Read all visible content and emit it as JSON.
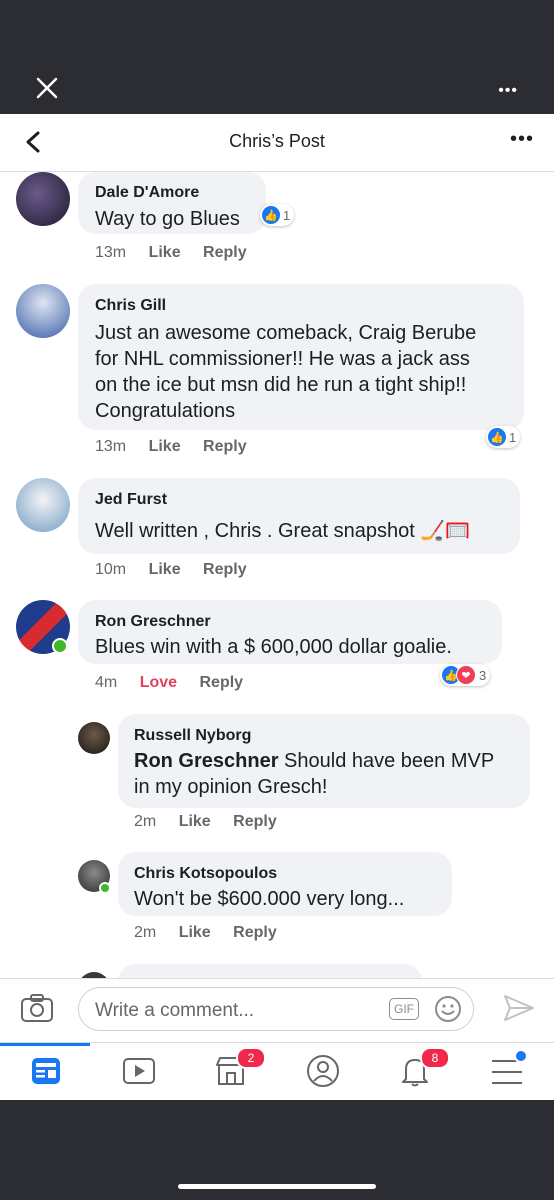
{
  "header": {
    "title": "Chris’s Post",
    "top_more": "•••",
    "more": "•••"
  },
  "comments": [
    {
      "author": "Dale D'Amore",
      "text": "Way to go Blues",
      "time": "13m",
      "like": "Like",
      "reply": "Reply",
      "reaction_count": "1"
    },
    {
      "author": "Chris Gill",
      "lines": [
        "Just an awesome comeback, Craig Berube",
        "for NHL commissioner!! He was a jack ass",
        "on the ice but msn did he run a tight ship!!",
        "Congratulations"
      ],
      "time": "13m",
      "like": "Like",
      "reply": "Reply",
      "reaction_count": "1"
    },
    {
      "author": "Jed Furst",
      "text": "Well written , Chris . Great snapshot 🏒🥅",
      "time": "10m",
      "like": "Like",
      "reply": "Reply"
    },
    {
      "author": "Ron Greschner",
      "text": "Blues win with a $ 600,000 dollar goalie.",
      "time": "4m",
      "like": "Love",
      "reply": "Reply",
      "reaction_count": "3"
    }
  ],
  "replies": [
    {
      "author": "Russell Nyborg",
      "mention": "Ron Greschner",
      "text": " Should have been MVP",
      "line2": "in my opinion Gresch!",
      "time": "2m",
      "like": "Like",
      "reply": "Reply"
    },
    {
      "author": "Chris Kotsopoulos",
      "text": "Won't be $600.000 very long...",
      "time": "2m",
      "like": "Like",
      "reply": "Reply"
    }
  ],
  "composer": {
    "placeholder": "Write a comment...",
    "gif": "GIF"
  },
  "tabs": {
    "marketplace_badge": "2",
    "notifications_badge": "8"
  },
  "colors": {
    "accent": "#1877f2",
    "love": "#e4405f",
    "badge": "#f02849",
    "chrome": "#2b2d33"
  }
}
